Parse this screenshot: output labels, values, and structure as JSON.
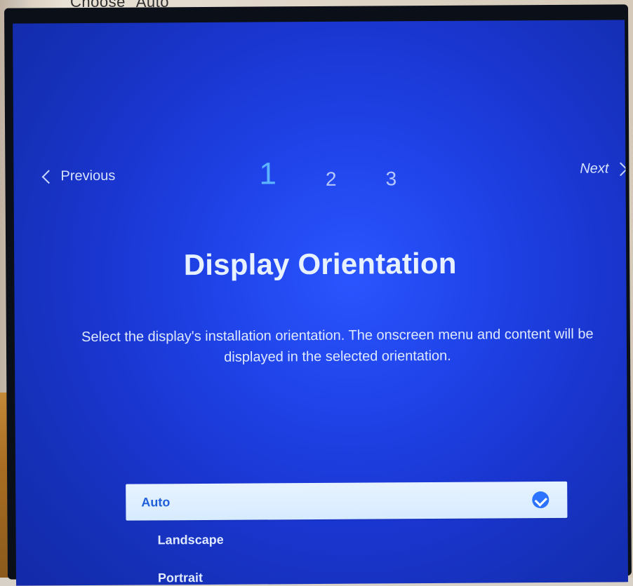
{
  "top_note": "Choose \"Auto\"",
  "nav": {
    "previous": "Previous",
    "next": "Next",
    "steps": [
      "1",
      "2",
      "3"
    ],
    "current_step": "1"
  },
  "dialog": {
    "title": "Display Orientation",
    "description": "Select the display's installation orientation. The onscreen menu and content will be displayed in the selected orientation.",
    "options": [
      {
        "label": "Auto",
        "selected": true
      },
      {
        "label": "Landscape",
        "selected": false
      },
      {
        "label": "Portrait",
        "selected": false
      }
    ]
  }
}
